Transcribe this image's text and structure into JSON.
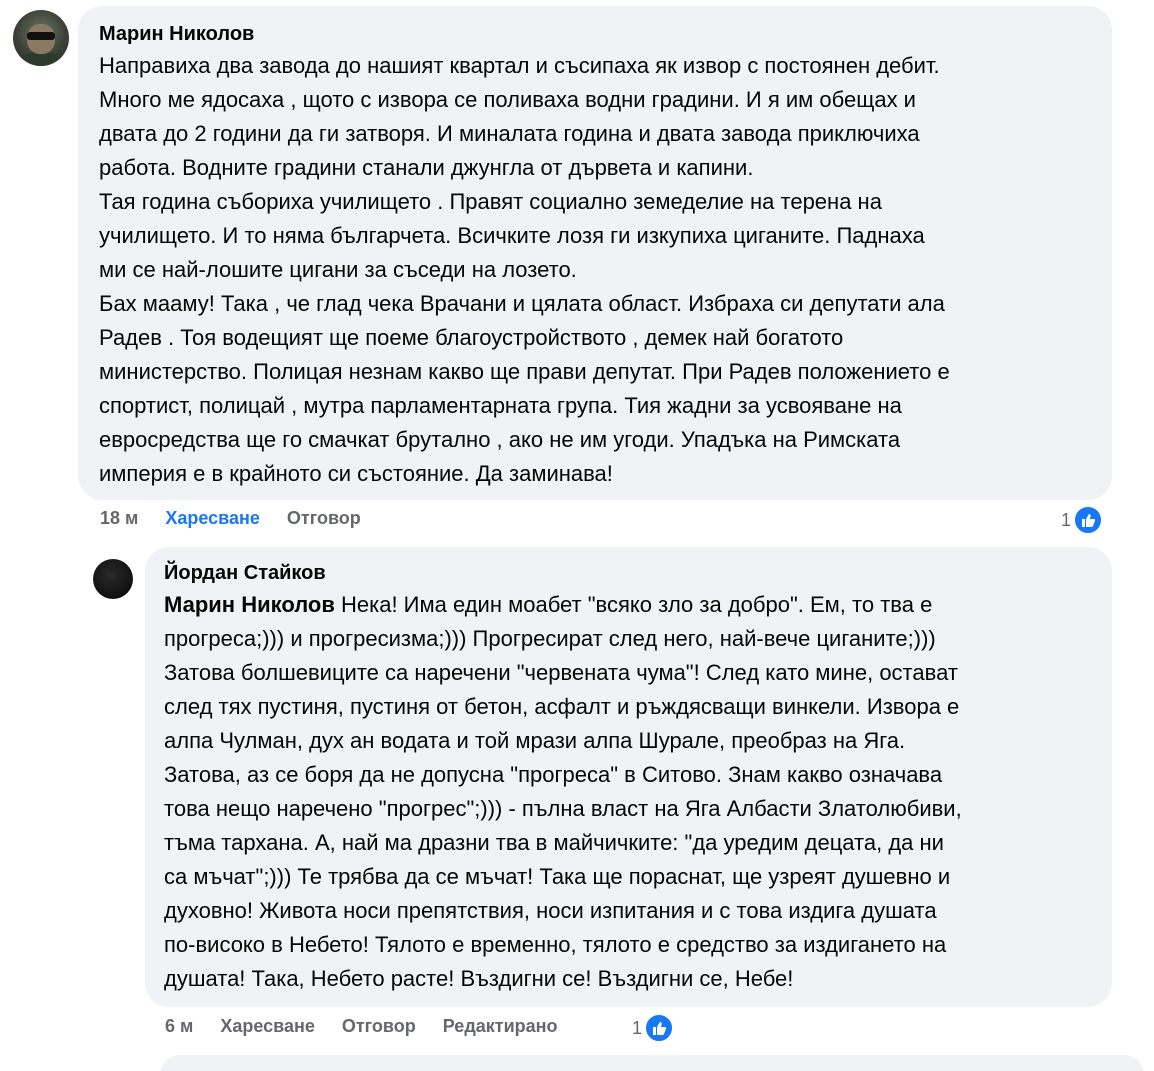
{
  "comments": [
    {
      "author": "Марин Николов",
      "text": "Направиха два завода до нашият квартал и съсипаха як извор с постоянен дебит.\nМного ме ядосаха , щото с извора се поливаха водни градини. И я им обещах и\nдвата до 2 години да ги затворя. И миналата година и двата завода приключиха\nработа. Водните градини станали джунгла от дървета и капини.\nТая година събориха училището . Правят социално земеделие на терена на\nучилището. И то няма българчета. Всичките лозя ги изкупиха циганите. Паднаха\nми се най-лошите цигани за съседи на лозето.\nБах мааму! Така , че глад чека Врачани и цялата област. Избраха си депутати ала\nРадев . Тоя водещият ще поеме благоустройството , демек най богатото\nминистерство. Полицая незнам какво ще прави депутат. При Радев положението е\nспортист, полицай , мутра парламентарната група. Тия жадни за усвояване на\nевросредства ще го смачкат брутално , ако не им угоди. Упадъка на Римската\nимперия е в крайното си състояние. Да заминава!",
      "time": "18 м",
      "like_label": "Харесване",
      "reply_label": "Отговор",
      "reaction_count": "1",
      "reaction_icon": "like-icon"
    },
    {
      "author": "Йордан Стайков",
      "mention": "Марин Николов",
      "text": " Нека! Има един моабет \"всяко зло за добро\". Ем, то тва е\nпрогреса;))) и прогресизма;))) Прогресират след него, най-вече циганите;)))\nЗатова болшевиците са наречени \"червената чума\"! След като мине, остават\nслед тях пустиня, пустиня от бетон, асфалт и ръждясващи винкели. Извора е\nалпа Чулман, дух ан водата и той мрази алпа Шурале, преобраз на Яга.\nЗатова, аз се боря да не допусна \"прогреса\" в Ситово. Знам какво означава\nтова нещо наречено \"прогрес\";))) - пълна власт на Яга Албасти Златолюбиви,\nтъма тархана. А, най ма дразни тва в майчичките: \"да уредим децата, да ни\nса мъчат\";))) Те трябва да се мъчат! Така ще пораснат, ще узреят душевно и\nдуховно! Живота носи препятствия, носи изпитания и с това издига душата\nпо-високо в Небето! Тялото е временно, тялото е средство за издигането на\nдушата! Така, Небето расте! Въздигни се! Въздигни се, Небе!",
      "time": "6 м",
      "like_label": "Харесване",
      "reply_label": "Отговор",
      "edited_label": "Редактирано",
      "reaction_count": "1",
      "reaction_icon": "like-icon"
    }
  ],
  "colors": {
    "bubble": "#f0f2f5",
    "liked": "#1877f2",
    "meta": "#65676b"
  }
}
